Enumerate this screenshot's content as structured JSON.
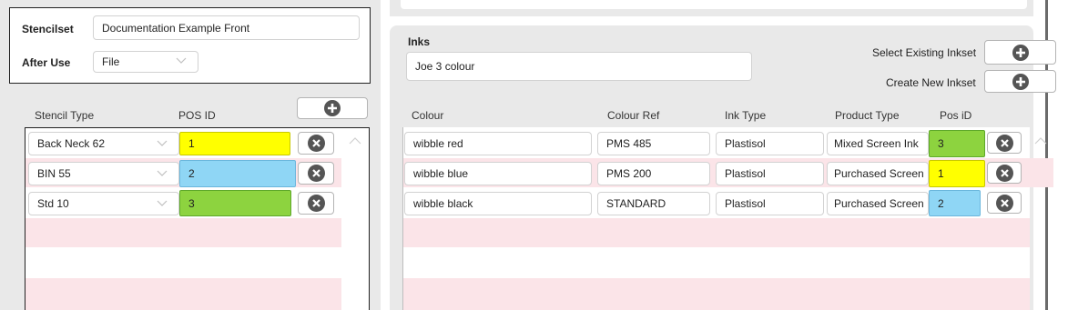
{
  "stencil": {
    "stencilset_label": "Stencilset",
    "stencilset_value": "Documentation Example Front",
    "afteruse_label": "After Use",
    "afteruse_value": "File",
    "col_stencil_type": "Stencil Type",
    "col_pos_id": "POS ID",
    "rows": [
      {
        "type": "Back Neck 62",
        "pos": "1",
        "pos_color": "#ffff00"
      },
      {
        "type": "BIN 55",
        "pos": "2",
        "pos_color": "#8fd6f5"
      },
      {
        "type": "Std 10",
        "pos": "3",
        "pos_color": "#8dd33f"
      }
    ]
  },
  "inks": {
    "title": "Inks",
    "inkset_value": "Joe 3 colour",
    "select_existing_label": "Select Existing Inkset",
    "create_new_label": "Create New Inkset",
    "col_colour": "Colour",
    "col_colour_ref": "Colour Ref",
    "col_ink_type": "Ink Type",
    "col_product_type": "Product Type",
    "col_pos_id": "Pos iD",
    "rows": [
      {
        "colour": "wibble red",
        "ref": "PMS 485",
        "ink": "Plastisol",
        "product": "Mixed Screen Ink",
        "pos": "3",
        "pos_color": "#8dd33f"
      },
      {
        "colour": "wibble blue",
        "ref": "PMS 200",
        "ink": "Plastisol",
        "product": "Purchased Screen",
        "pos": "1",
        "pos_color": "#ffff00"
      },
      {
        "colour": "wibble black",
        "ref": "STANDARD",
        "ink": "Plastisol",
        "product": "Purchased Screen",
        "pos": "2",
        "pos_color": "#8fd6f5"
      }
    ]
  },
  "icons": {
    "add": "plus-circle-icon",
    "remove": "x-circle-icon",
    "dropdown": "chevron-down-icon"
  }
}
